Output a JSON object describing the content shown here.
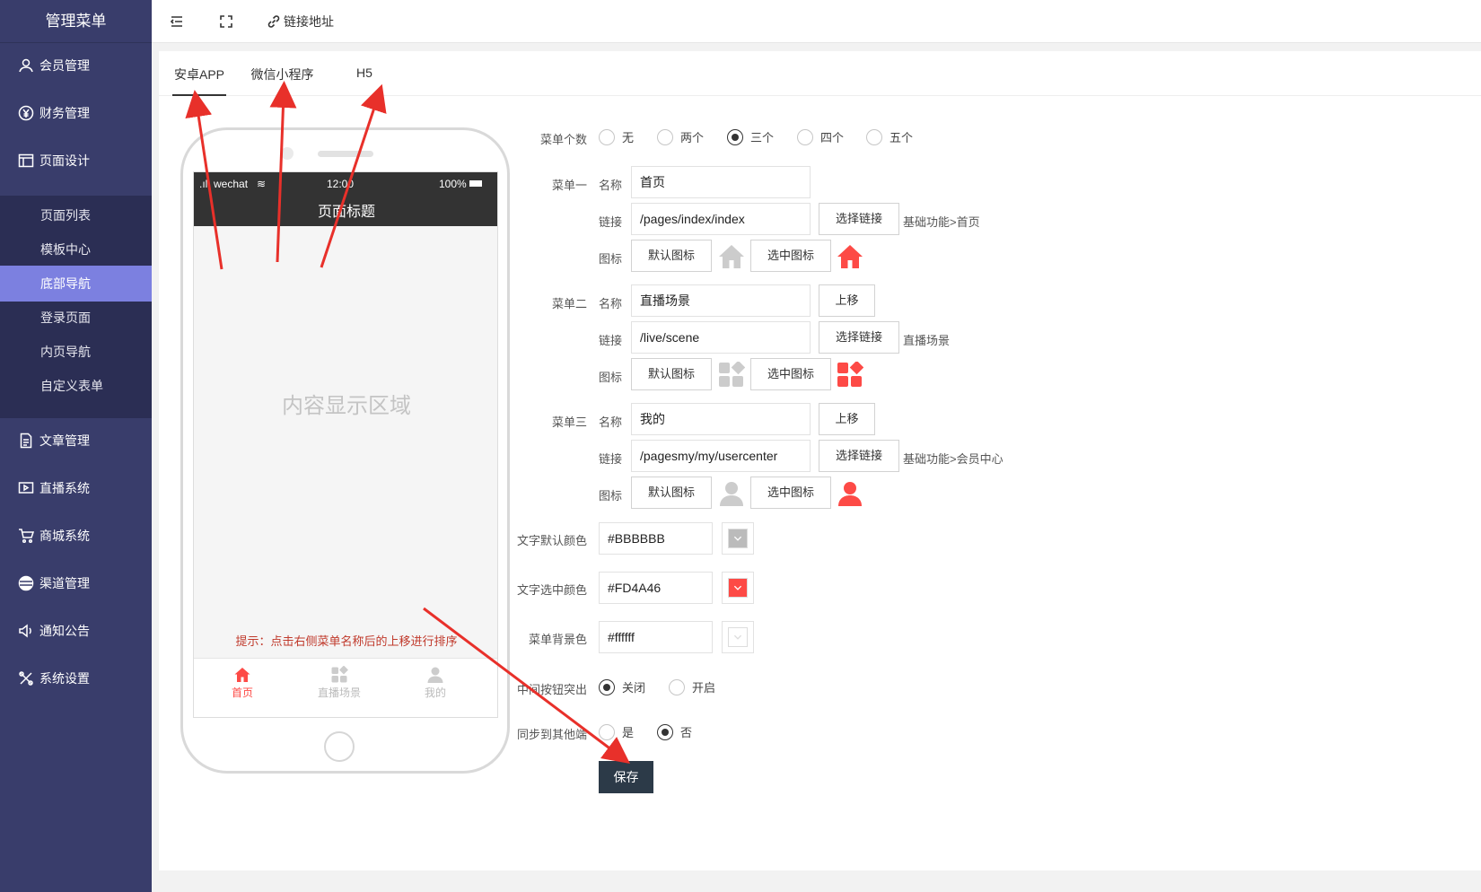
{
  "sidebar": {
    "title": "管理菜单",
    "items": [
      {
        "label": "会员管理",
        "icon": "user-icon"
      },
      {
        "label": "财务管理",
        "icon": "yen-icon"
      },
      {
        "label": "页面设计",
        "icon": "layout-icon"
      },
      {
        "label": "文章管理",
        "icon": "document-icon"
      },
      {
        "label": "直播系统",
        "icon": "video-icon"
      },
      {
        "label": "商城系统",
        "icon": "cart-icon"
      },
      {
        "label": "渠道管理",
        "icon": "channel-icon"
      },
      {
        "label": "通知公告",
        "icon": "speaker-icon"
      },
      {
        "label": "系统设置",
        "icon": "tools-icon"
      }
    ],
    "sub_items": [
      "页面列表",
      "模板中心",
      "底部导航",
      "登录页面",
      "内页导航",
      "自定义表单"
    ],
    "active_sub": "底部导航"
  },
  "topbar": {
    "link_label": "链接地址"
  },
  "tabs": [
    "安卓APP",
    "微信小程序",
    "H5"
  ],
  "phone": {
    "carrier": "wechat",
    "time": "12:00",
    "battery": "100%",
    "page_title": "页面标题",
    "content_placeholder": "内容显示区域",
    "hint": "提示：点击右侧菜单名称后的上移进行排序",
    "tabbar": [
      "首页",
      "直播场景",
      "我的"
    ]
  },
  "form": {
    "menu_count_label": "菜单个数",
    "menu_count_options": [
      "无",
      "两个",
      "三个",
      "四个",
      "五个"
    ],
    "menu_count_selected": "三个",
    "name_label": "名称",
    "link_label": "链接",
    "icon_label": "图标",
    "select_link_button": "选择链接",
    "default_icon_button": "默认图标",
    "selected_icon_button": "选中图标",
    "move_up_button": "上移",
    "menus": [
      {
        "label": "菜单一",
        "name": "首页",
        "link": "/pages/index/index",
        "link_desc": "基础功能>首页",
        "icon": "home-icon"
      },
      {
        "label": "菜单二",
        "name": "直播场景",
        "link": "/live/scene",
        "link_desc": "直播场景",
        "icon": "grid-icon"
      },
      {
        "label": "菜单三",
        "name": "我的",
        "link": "/pagesmy/my/usercenter",
        "link_desc": "基础功能>会员中心",
        "icon": "person-icon"
      }
    ],
    "text_default_color_label": "文字默认颜色",
    "text_default_color": "#BBBBBB",
    "text_selected_color_label": "文字选中颜色",
    "text_selected_color": "#FD4A46",
    "menu_bg_color_label": "菜单背景色",
    "menu_bg_color": "#ffffff",
    "center_button_label": "中间按钮突出",
    "center_button_options": [
      "关闭",
      "开启"
    ],
    "center_button_selected": "关闭",
    "sync_label": "同步到其他端",
    "sync_options": [
      "是",
      "否"
    ],
    "sync_selected": "否",
    "save_button": "保存"
  },
  "colors": {
    "sidebar_bg": "#393d6b",
    "submenu_bg": "#2b2e54",
    "active_sub_bg": "#7c80e0",
    "accent_red": "#FD4A46",
    "icon_gray": "#cccccc",
    "annotation_arrow": "#e8302a"
  }
}
